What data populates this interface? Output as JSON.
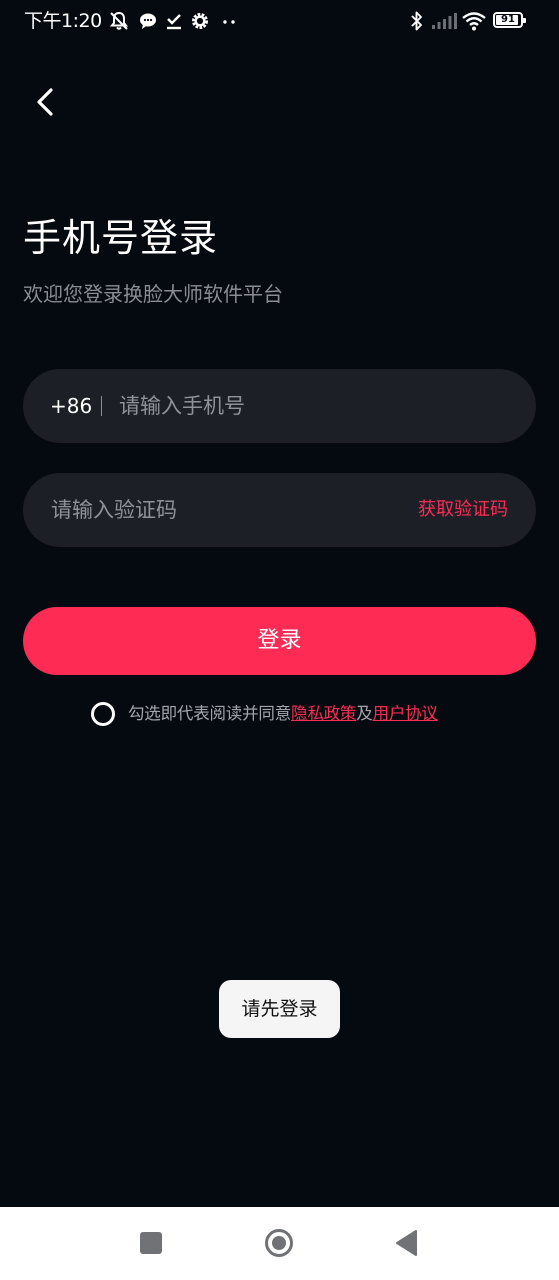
{
  "status_bar": {
    "time": "下午1:20",
    "battery_level": "91",
    "icons": [
      "mute-notification-icon",
      "chat-bubble-icon",
      "download-done-icon",
      "settings-gear-icon",
      "more-dots-icon",
      "bluetooth-icon",
      "cellular-signal-icon",
      "wifi-icon",
      "battery-icon"
    ]
  },
  "header": {
    "back_icon": "chevron-left-icon",
    "title": "手机号登录",
    "subtitle": "欢迎您登录换脸大师软件平台"
  },
  "phone_field": {
    "country_code": "+86",
    "placeholder": "请输入手机号",
    "value": ""
  },
  "code_field": {
    "placeholder": "请输入验证码",
    "value": "",
    "get_code_label": "获取验证码"
  },
  "login_button": {
    "label": "登录"
  },
  "agreement": {
    "checked": false,
    "prefix": "勾选即代表阅读并同意",
    "privacy_link": "隐私政策",
    "and": "及",
    "user_link": "用户协议"
  },
  "toast": {
    "message": "请先登录"
  },
  "nav_bar": {
    "icons": [
      "recents-square-icon",
      "home-circle-icon",
      "back-triangle-icon"
    ]
  },
  "colors": {
    "background": "#050a11",
    "accent": "#fe2b54",
    "field_background": "#1c1f26",
    "secondary_text": "#8a8d93"
  }
}
